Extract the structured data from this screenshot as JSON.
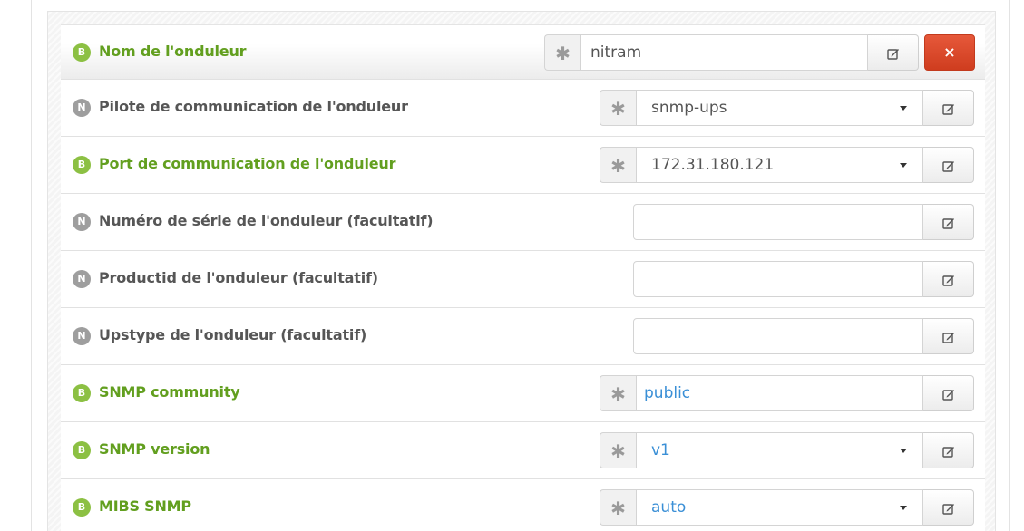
{
  "rows": [
    {
      "badge": "B",
      "label": "Nom de l'onduleur",
      "value": "nitram",
      "close_label": "×"
    },
    {
      "badge": "N",
      "label": "Pilote de communication de l'onduleur",
      "value": "snmp-ups"
    },
    {
      "badge": "B",
      "label": "Port de communication de l'onduleur",
      "value": "172.31.180.121"
    },
    {
      "badge": "N",
      "label": "Numéro de série de l'onduleur (facultatif)",
      "value": ""
    },
    {
      "badge": "N",
      "label": "Productid de l'onduleur (facultatif)",
      "value": ""
    },
    {
      "badge": "N",
      "label": "Upstype de l'onduleur (facultatif)",
      "value": ""
    },
    {
      "badge": "B",
      "label": "SNMP community",
      "value": "public"
    },
    {
      "badge": "B",
      "label": "SNMP version",
      "value": "v1"
    },
    {
      "badge": "B",
      "label": "MIBS SNMP",
      "value": "auto"
    }
  ],
  "required_marker": "✱",
  "icons": {
    "edit": "edit-icon",
    "required": "asterisk-icon",
    "dropdown": "caret-down-icon",
    "close": "close-icon"
  },
  "colors": {
    "basic_badge": "#8cc043",
    "normal_badge": "#9e9e9e",
    "basic_label": "#629f1f",
    "delete_button": "#dc4a2b",
    "link_value": "#3a8fd6"
  }
}
